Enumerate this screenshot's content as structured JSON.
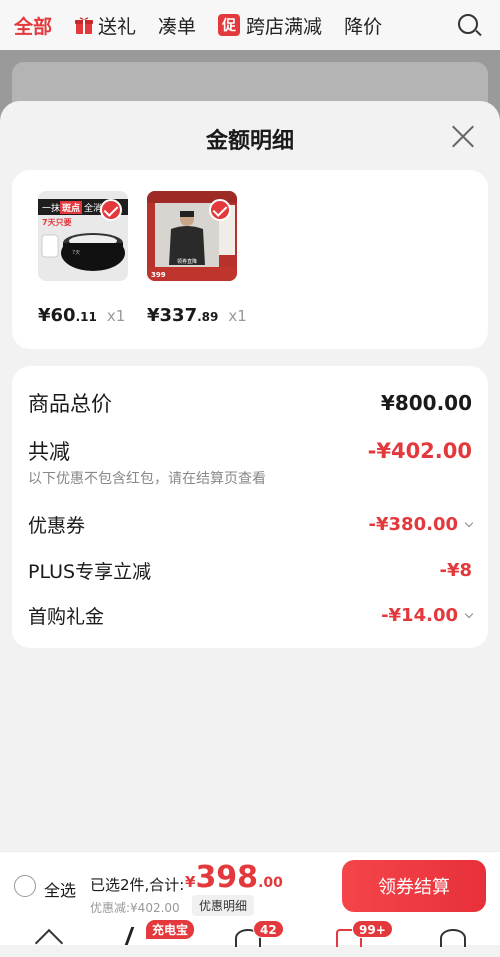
{
  "topbar": {
    "tabs": [
      {
        "label": "全部",
        "active": true
      },
      {
        "label": "送礼",
        "icon": "gift-icon"
      },
      {
        "label": "凑单"
      },
      {
        "label": "跨店满减",
        "badge": "促"
      },
      {
        "label": "降价"
      }
    ],
    "search_icon": "search-icon"
  },
  "sheet": {
    "title": "金额明细",
    "close_icon": "close-icon",
    "products": [
      {
        "image_text": [
          "一抹",
          "斑点",
          "全消",
          "7天只要",
          "7天"
        ],
        "price_int": "¥60",
        "price_dec": ".11",
        "qty": "x1",
        "checked": true
      },
      {
        "image_text": [
          "399",
          "领券直降"
        ],
        "price_int": "¥337",
        "price_dec": ".89",
        "qty": "x1",
        "checked": true
      }
    ],
    "details": {
      "total_label": "商品总价",
      "total_value": "¥800.00",
      "discount_label": "共减",
      "discount_value": "-¥402.00",
      "discount_note": "以下优惠不包含红包，请在结算页查看",
      "items": [
        {
          "label": "优惠券",
          "value": "-¥380.00",
          "expandable": true
        },
        {
          "label": "PLUS专享立减",
          "value": "-¥8",
          "expandable": false
        },
        {
          "label": "首购礼金",
          "value": "-¥14.00",
          "expandable": true
        }
      ]
    }
  },
  "bottom_bar": {
    "select_all": "全选",
    "summary_prefix": "已选2件,合计:",
    "total_symbol": "¥",
    "total_int": "398",
    "total_dec": ".00",
    "saved": "优惠减:¥402.00",
    "detail_button": "优惠明细",
    "checkout": "领券结算"
  },
  "nav": {
    "charge_badge": "充电宝",
    "message_badge": "42",
    "cart_badge": "99+"
  },
  "colors": {
    "accent": "#e4393c",
    "background": "#f2f2f2",
    "card": "#ffffff"
  }
}
